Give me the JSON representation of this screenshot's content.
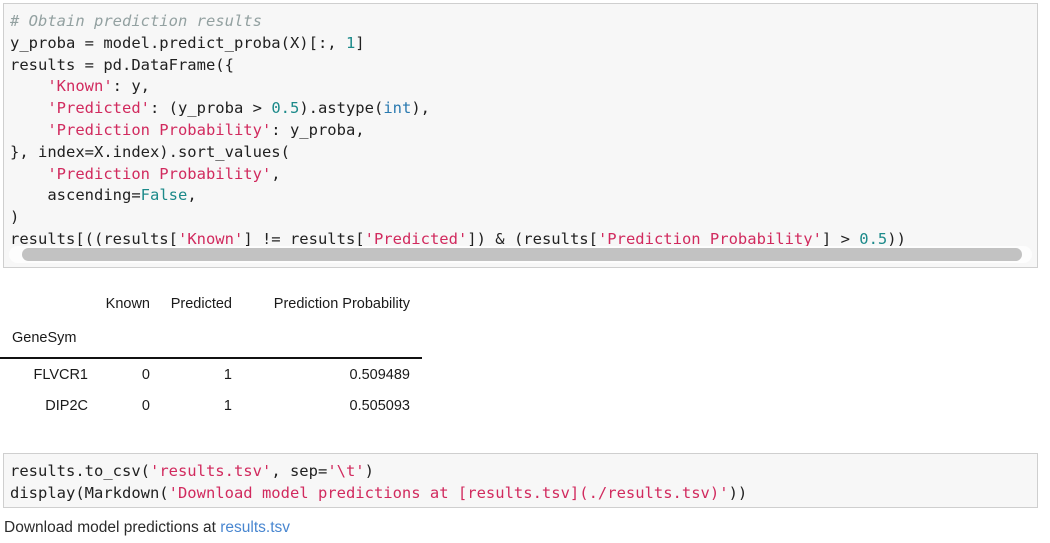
{
  "cells": {
    "top_code": {
      "name": "prediction-results-code",
      "lines": [
        [
          {
            "t": "comment",
            "s": "# Obtain prediction results"
          }
        ],
        [
          {
            "t": "plain",
            "s": "y_proba = model.predict_proba(X)[:, "
          },
          {
            "t": "number",
            "s": "1"
          },
          {
            "t": "plain",
            "s": "]"
          }
        ],
        [
          {
            "t": "plain",
            "s": "results = pd.DataFrame({"
          }
        ],
        [
          {
            "t": "plain",
            "s": "    "
          },
          {
            "t": "string",
            "s": "'Known'"
          },
          {
            "t": "plain",
            "s": ": y,"
          }
        ],
        [
          {
            "t": "plain",
            "s": "    "
          },
          {
            "t": "string",
            "s": "'Predicted'"
          },
          {
            "t": "plain",
            "s": ": (y_proba > "
          },
          {
            "t": "number",
            "s": "0.5"
          },
          {
            "t": "plain",
            "s": ").astype("
          },
          {
            "t": "builtin",
            "s": "int"
          },
          {
            "t": "plain",
            "s": "),"
          }
        ],
        [
          {
            "t": "plain",
            "s": "    "
          },
          {
            "t": "string",
            "s": "'Prediction Probability'"
          },
          {
            "t": "plain",
            "s": ": y_proba,"
          }
        ],
        [
          {
            "t": "plain",
            "s": "}, index=X.index).sort_values("
          }
        ],
        [
          {
            "t": "plain",
            "s": "    "
          },
          {
            "t": "string",
            "s": "'Prediction Probability'"
          },
          {
            "t": "plain",
            "s": ","
          }
        ],
        [
          {
            "t": "plain",
            "s": "    ascending="
          },
          {
            "t": "keyword",
            "s": "False"
          },
          {
            "t": "plain",
            "s": ","
          }
        ],
        [
          {
            "t": "plain",
            "s": ")"
          }
        ],
        [
          {
            "t": "plain",
            "s": "results[((results["
          },
          {
            "t": "string",
            "s": "'Known'"
          },
          {
            "t": "plain",
            "s": "] != results["
          },
          {
            "t": "string",
            "s": "'Predicted'"
          },
          {
            "t": "plain",
            "s": "]) & (results["
          },
          {
            "t": "string",
            "s": "'Prediction Probability'"
          },
          {
            "t": "plain",
            "s": "] > "
          },
          {
            "t": "number",
            "s": "0.5"
          },
          {
            "t": "plain",
            "s": "))"
          }
        ]
      ]
    },
    "bottom_code": {
      "name": "save-results-code",
      "lines": [
        [
          {
            "t": "plain",
            "s": "results.to_csv("
          },
          {
            "t": "string",
            "s": "'results.tsv'"
          },
          {
            "t": "plain",
            "s": ", sep="
          },
          {
            "t": "string",
            "s": "'\\t'"
          },
          {
            "t": "plain",
            "s": ")"
          }
        ],
        [
          {
            "t": "plain",
            "s": "display(Markdown("
          },
          {
            "t": "string",
            "s": "'Download model predictions at [results.tsv](./results.tsv)'"
          },
          {
            "t": "plain",
            "s": "))"
          }
        ]
      ]
    }
  },
  "dataframe": {
    "index_name": "GeneSym",
    "columns": [
      "Known",
      "Predicted",
      "Prediction Probability"
    ],
    "rows": [
      {
        "index": "FLVCR1",
        "known": "0",
        "predicted": "1",
        "probability": "0.509489"
      },
      {
        "index": "DIP2C",
        "known": "0",
        "predicted": "1",
        "probability": "0.505093"
      }
    ]
  },
  "markdown_output": {
    "prefix": "Download model predictions at ",
    "link_text": "results.tsv"
  },
  "colors": {
    "string": "#d12a5e",
    "number": "#1c8a8a",
    "builtin": "#2a7ab0",
    "keyword": "#1c8a8a",
    "comment": "#93a1a1",
    "link": "#4886d0",
    "cell_bg": "#f7f7f7",
    "cell_border": "#cfcfcf",
    "scrollbar_thumb": "#c2c2c2"
  }
}
